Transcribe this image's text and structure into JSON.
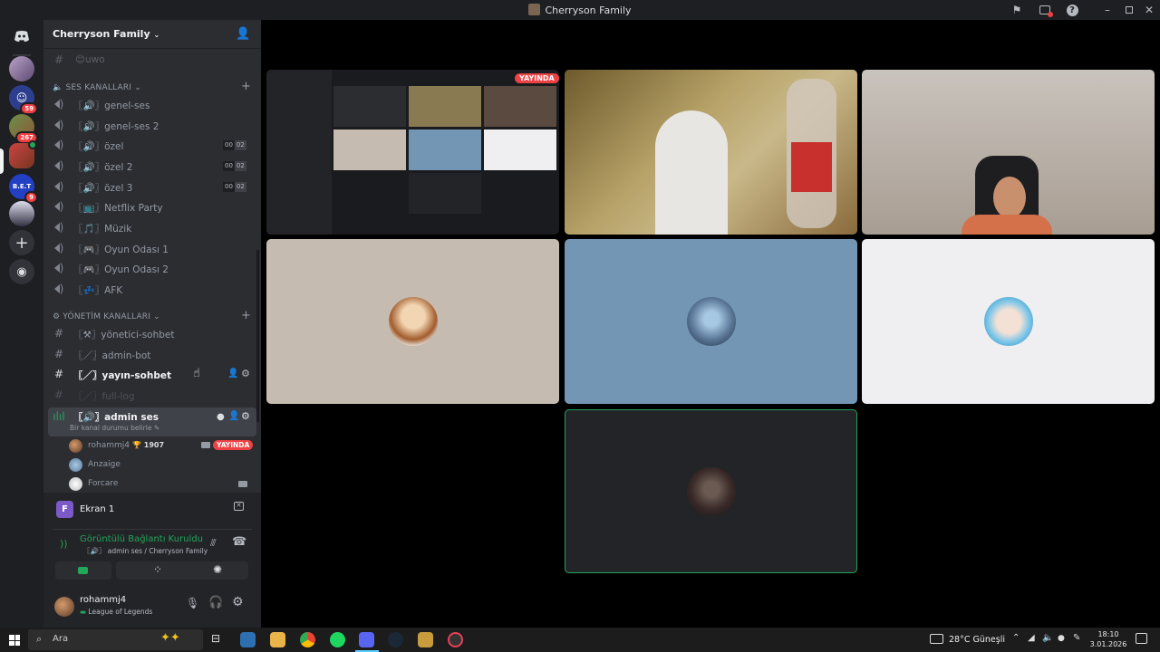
{
  "window": {
    "title": "Cherryson Family"
  },
  "guilds": [
    {
      "badge": ""
    },
    {
      "badge": "59"
    },
    {
      "badge": "267"
    },
    {
      "badge": ""
    },
    {
      "label": "B.E.T",
      "badge": "9"
    },
    {
      "badge": ""
    }
  ],
  "server": {
    "name": "Cherryson Family",
    "top_channel": "uwo",
    "voice_category": "SES KANALLARI",
    "admin_category": "YÖNETİM KANALLARI"
  },
  "voice_channels": [
    {
      "label": "genel-ses",
      "prefix": "〖🔊〗"
    },
    {
      "label": "genel-ses 2",
      "prefix": "〖🔊〗"
    },
    {
      "label": "özel",
      "prefix": "〖🔊〗",
      "count": "00",
      "limit": "02"
    },
    {
      "label": "özel 2",
      "prefix": "〖🔊〗",
      "count": "00",
      "limit": "02"
    },
    {
      "label": "özel 3",
      "prefix": "〖🔊〗",
      "count": "00",
      "limit": "02"
    },
    {
      "label": "Netflix Party",
      "prefix": "〖📺〗"
    },
    {
      "label": "Müzik",
      "prefix": "〖🎵〗"
    },
    {
      "label": "Oyun Odası 1",
      "prefix": "〖🎮〗"
    },
    {
      "label": "Oyun Odası 2",
      "prefix": "〖🎮〗"
    },
    {
      "label": "AFK",
      "prefix": "〖💤〗"
    }
  ],
  "admin_channels": [
    {
      "label": "yönetici-sohbet",
      "prefix": "〖⚒〗"
    },
    {
      "label": "admin-bot",
      "prefix": "〖／〗"
    },
    {
      "label": "yayın-sohbet",
      "prefix": "〖／〗"
    },
    {
      "label": "full-log",
      "prefix": "〖／〗"
    }
  ],
  "active_voice": {
    "label": "admin ses",
    "prefix": "〖🔊〗",
    "status": "Bir kanal durumu belirle",
    "members": [
      {
        "name": "rohammj4",
        "score": "1907",
        "live": "YAYINDA"
      },
      {
        "name": "Anzaige"
      },
      {
        "name": "Forcare"
      }
    ]
  },
  "screen_share": {
    "icon_letter": "F",
    "label": "Ekran 1"
  },
  "connection": {
    "status": "Görüntülü Bağlantı Kuruldu",
    "channel": "〖🔊〗 admin ses / Cherryson Family"
  },
  "user": {
    "name": "rohammj4",
    "activity": "League of Legends"
  },
  "stream": {
    "live_badge": "YAYINDA"
  },
  "taskbar": {
    "search": "Ara",
    "weather": "28°C Güneşli",
    "time": "18:10",
    "date": "3.01.2026"
  },
  "colors": {
    "accent": "#5865f2",
    "live": "#ed4245",
    "connected": "#23a55a",
    "tile_tan": "#c5bbb1",
    "tile_blue": "#7496b5",
    "tile_white": "#efeef0"
  }
}
